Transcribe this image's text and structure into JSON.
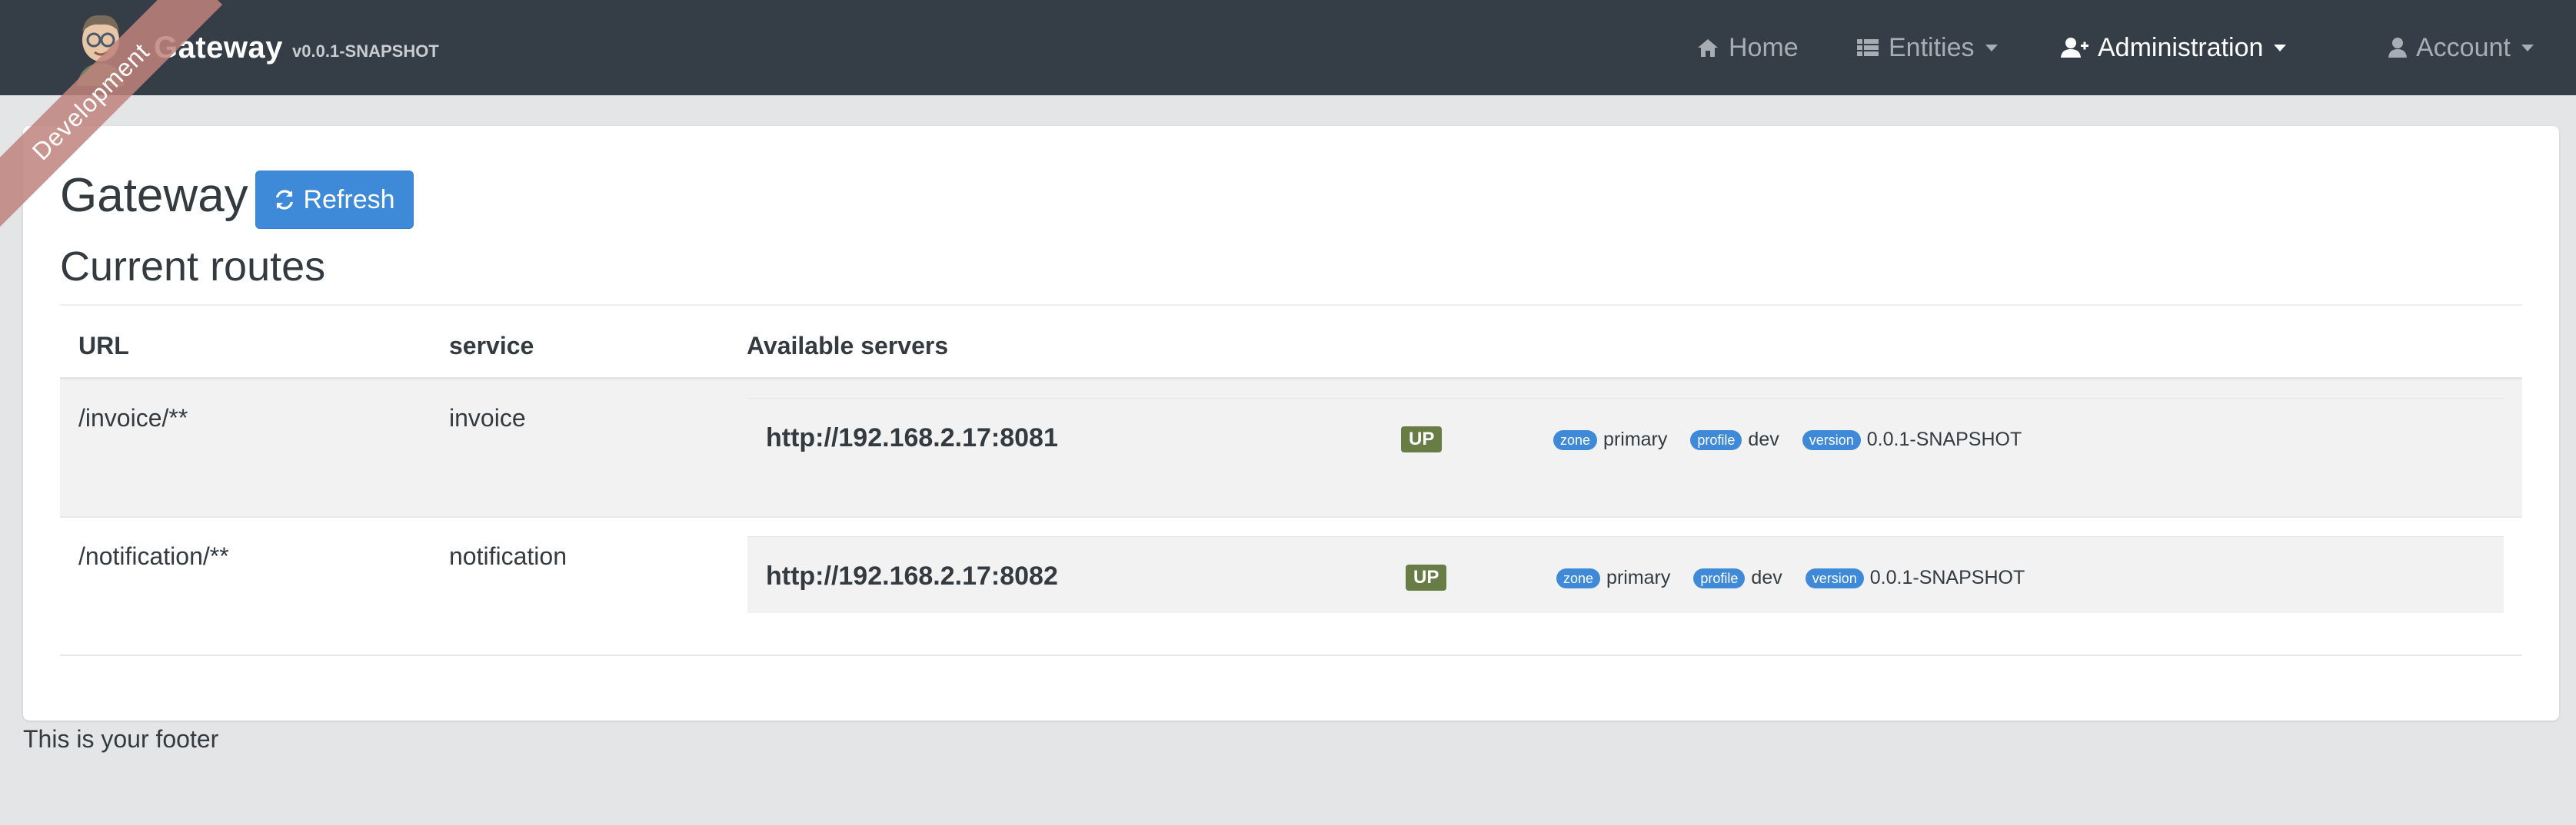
{
  "navbar": {
    "brand_title": "Gateway",
    "brand_version": "v0.0.1-SNAPSHOT",
    "ribbon_text": "Development",
    "items": [
      {
        "label": "Home",
        "icon": "home-icon"
      },
      {
        "label": "Entities",
        "icon": "list-icon"
      },
      {
        "label": "Administration",
        "icon": "user-plus-icon"
      },
      {
        "label": "Account",
        "icon": "user-icon"
      }
    ]
  },
  "page": {
    "title": "Gateway",
    "refresh_label": "Refresh",
    "section_title": "Current routes"
  },
  "routes_table": {
    "columns": [
      "URL",
      "service",
      "Available servers"
    ],
    "rows": [
      {
        "url": "/invoice/**",
        "service": "invoice",
        "server": {
          "address": "http://192.168.2.17:8081",
          "status": "UP",
          "zone_tag": "zone",
          "zone": "primary",
          "profile_tag": "profile",
          "profile": "dev",
          "version_tag": "version",
          "version": "0.0.1-SNAPSHOT"
        }
      },
      {
        "url": "/notification/**",
        "service": "notification",
        "server": {
          "address": "http://192.168.2.17:8082",
          "status": "UP",
          "zone_tag": "zone",
          "zone": "primary",
          "profile_tag": "profile",
          "profile": "dev",
          "version_tag": "version",
          "version": "0.0.1-SNAPSHOT"
        }
      }
    ]
  },
  "footer": {
    "text": "This is your footer"
  },
  "colors": {
    "navbar_bg": "#353d47",
    "primary": "#3e8ad8",
    "status_up": "#677d45",
    "ribbon": "#c0827c"
  }
}
